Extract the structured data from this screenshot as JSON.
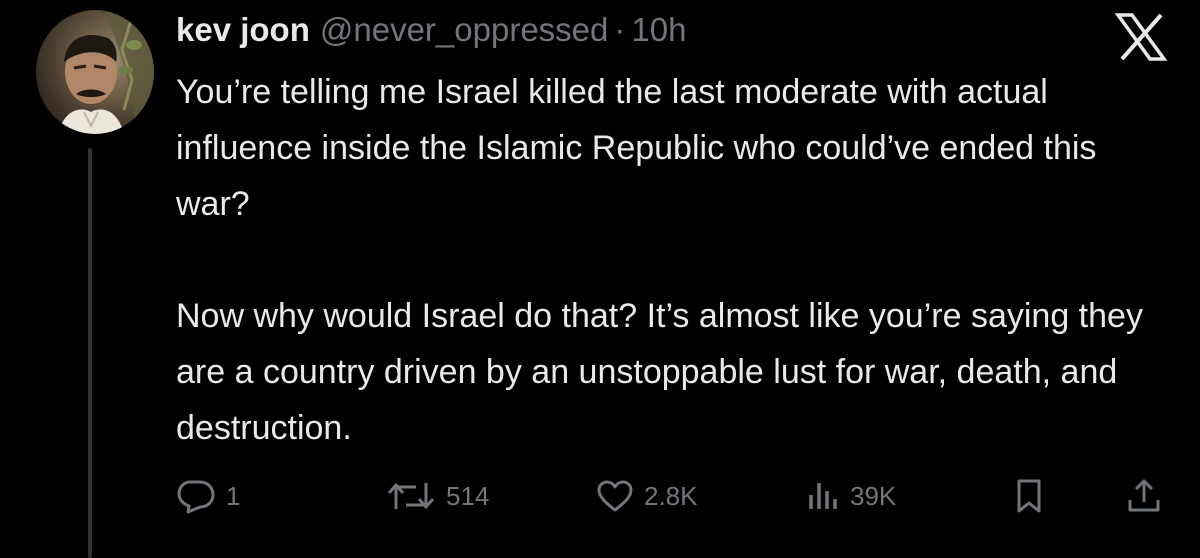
{
  "tweet": {
    "display_name": "kev joon",
    "handle": "@never_oppressed",
    "separator": "·",
    "time": "10h",
    "paragraphs": [
      "You’re telling me Israel killed the last moderate with actual influence inside the Islamic Republic who could’ve ended this war?",
      "Now why would Israel do that? It’s almost like you’re saying they are a country driven by an unstoppable lust for war, death, and destruction."
    ]
  },
  "actions": {
    "reply": {
      "icon": "reply-icon",
      "count": "1"
    },
    "retweet": {
      "icon": "retweet-icon",
      "count": "514"
    },
    "like": {
      "icon": "heart-icon",
      "count": "2.8K"
    },
    "views": {
      "icon": "views-chart-icon",
      "count": "39K"
    },
    "bookmark": {
      "icon": "bookmark-icon"
    },
    "share": {
      "icon": "share-icon"
    }
  },
  "branding": {
    "logo_icon": "x-logo-icon"
  },
  "colors": {
    "background": "#000000",
    "text_primary": "#e7e9ea",
    "text_secondary": "#71767b",
    "thread_line": "#2f3336"
  }
}
